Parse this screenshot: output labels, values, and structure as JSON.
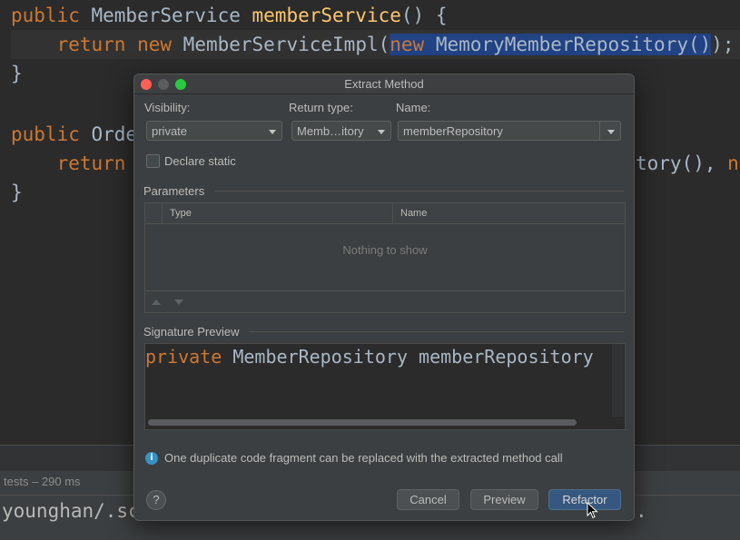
{
  "code": {
    "line1": {
      "kw": "public",
      "type": " MemberService ",
      "fn": "memberService",
      "rest": "() {"
    },
    "line2": {
      "indent": "    ",
      "kw1": "return",
      "sp1": " ",
      "kw2": "new",
      "pre": " MemberServiceImpl(",
      "sel_kw": "new",
      "sel_rest": " MemoryMemberRepository()",
      "post": ");"
    },
    "line3": "}",
    "line4": {
      "kw": "public",
      "rest": " Orde"
    },
    "line5": {
      "indent": "    ",
      "kw": "return"
    },
    "line5_tail": {
      "rest": "tory(), ",
      "kw": "ne"
    },
    "line6": "}"
  },
  "run_panel": {
    "status": "tests – 290 ms",
    "terminal_text": "younghan/.sc",
    "terminal_right": "."
  },
  "dialog": {
    "title": "Extract Method",
    "visibility_label": "Visibility:",
    "visibility_value": "private",
    "return_type_label": "Return type:",
    "return_type_value": "Memb…itory",
    "name_label": "Name:",
    "name_value": "memberRepository",
    "declare_static_label": "Declare static",
    "declare_static_checked": false,
    "parameters_title": "Parameters",
    "table_headers": {
      "type": "Type",
      "name": "Name"
    },
    "table_empty": "Nothing to show",
    "signature_title": "Signature Preview",
    "signature": {
      "kw": "private",
      "rest": " MemberRepository memberRepository"
    },
    "info_text": "One duplicate code fragment can be replaced with the extracted method call",
    "help_label": "?",
    "buttons": {
      "cancel": "Cancel",
      "preview": "Preview",
      "refactor": "Refactor"
    }
  },
  "colors": {
    "editor_bg": "#2b2b2b",
    "keyword": "#cc7832",
    "method": "#ffc66d",
    "text": "#a9b7c6",
    "selection": "#214283",
    "dialog_bg": "#3c3f41",
    "primary_button": "#365880",
    "info": "#3592c4"
  }
}
